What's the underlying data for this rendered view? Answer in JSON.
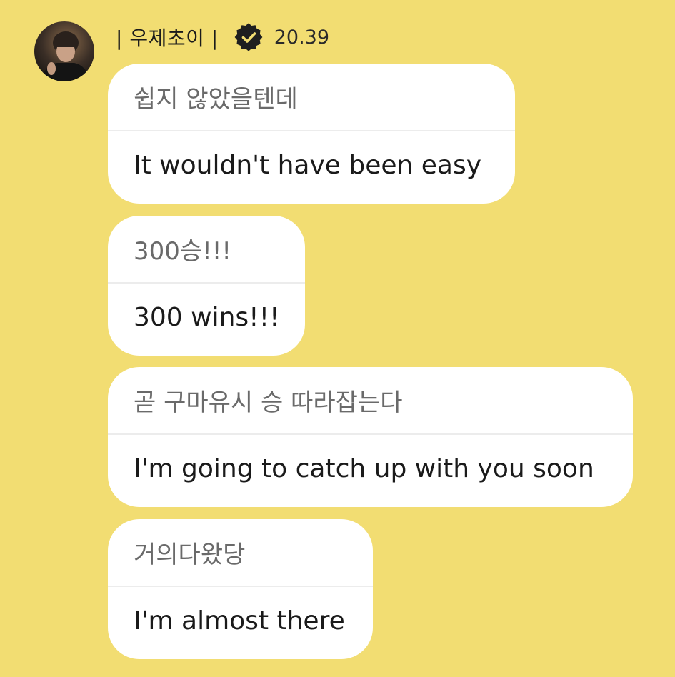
{
  "header": {
    "sender_name": "| 우제초이 |",
    "verified_icon": "verified-badge-icon",
    "timestamp": "20.39"
  },
  "avatar": {
    "icon": "profile-photo-icon"
  },
  "messages": [
    {
      "original": "쉽지 않았을텐데",
      "translation": "It wouldn't have been easy"
    },
    {
      "original": "300승!!!",
      "translation": "300 wins!!!"
    },
    {
      "original": "곧 구마유시 승 따라잡는다",
      "translation": "I'm going to catch up with you soon"
    },
    {
      "original": "거의다왔당",
      "translation": "I'm almost there"
    }
  ],
  "colors": {
    "background": "#F2DD72",
    "bubble": "#FFFFFF",
    "original_text": "#6A6A6A",
    "translation_text": "#1A1A1A",
    "divider": "#ECECEC"
  }
}
